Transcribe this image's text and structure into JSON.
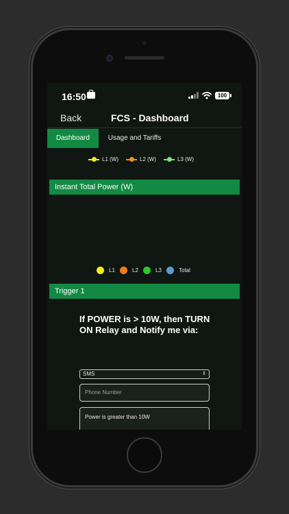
{
  "status": {
    "time": "16:50",
    "battery": "100"
  },
  "nav": {
    "back": "Back",
    "title": "FCS - Dashboard"
  },
  "tabs": [
    {
      "label": "Dashboard",
      "active": true
    },
    {
      "label": "Usage and Tariffs",
      "active": false
    }
  ],
  "energy_legend": [
    {
      "label": "L1 (W)",
      "color": "#f2ee1a"
    },
    {
      "label": "L2 (W)",
      "color": "#f0901b"
    },
    {
      "label": "L3 (W)",
      "color": "#7ee57a"
    }
  ],
  "instant_power": {
    "header": "Instant Total Power (W)",
    "legend": [
      {
        "label": "L1",
        "color": "#f2ee1a"
      },
      {
        "label": "L2",
        "color": "#f07d1b"
      },
      {
        "label": "L3",
        "color": "#2ec92a"
      },
      {
        "label": "Total",
        "color": "#5b9bd8"
      }
    ]
  },
  "trigger": {
    "header": "Trigger 1",
    "text": "If POWER is > 10W, then TURN ON Relay and Notify me via:",
    "select_value": "SMS",
    "phone_placeholder": "Phone Number",
    "message": "Power is greater than 10W"
  }
}
